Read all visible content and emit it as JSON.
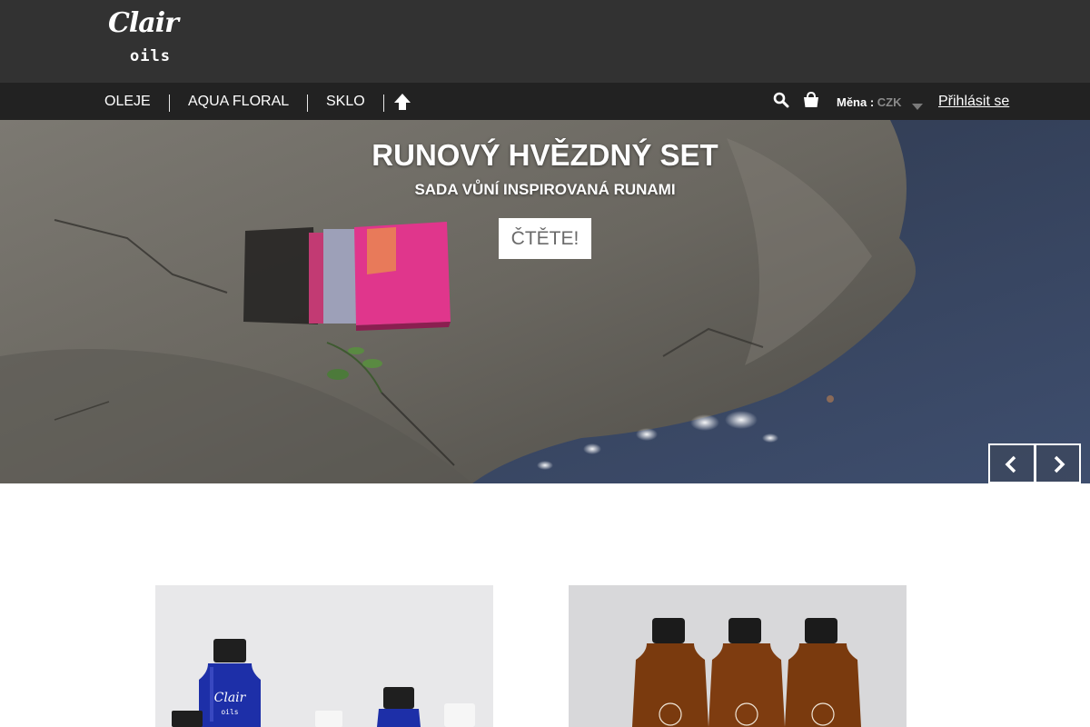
{
  "brand": {
    "logo_script": "Clair",
    "logo_sub": "oils"
  },
  "nav": {
    "items": [
      {
        "label": "OLEJE"
      },
      {
        "label": "AQUA FLORAL"
      },
      {
        "label": "SKLO"
      }
    ],
    "home_icon": "home-icon",
    "search_icon": "search-icon",
    "cart_icon": "cart-icon",
    "currency_label": "Měna :",
    "currency_value": "CZK",
    "login_label": "Přihlásit se"
  },
  "hero": {
    "title": "RUNOVÝ HVĚZDNÝ SET",
    "subtitle": "SADA VŮNÍ INSPIROVANÁ RUNAMI",
    "cta_label": "ČTĚTE!",
    "prev_icon": "chevron-left-icon",
    "next_icon": "chevron-right-icon"
  },
  "products": [
    {
      "name": "product-image-blue-bottles"
    },
    {
      "name": "product-image-amber-bottles"
    }
  ],
  "colors": {
    "header_bg": "#323232",
    "nav_bg": "#222222",
    "text_white": "#ffffff",
    "currency_muted": "#8a8a8a"
  }
}
